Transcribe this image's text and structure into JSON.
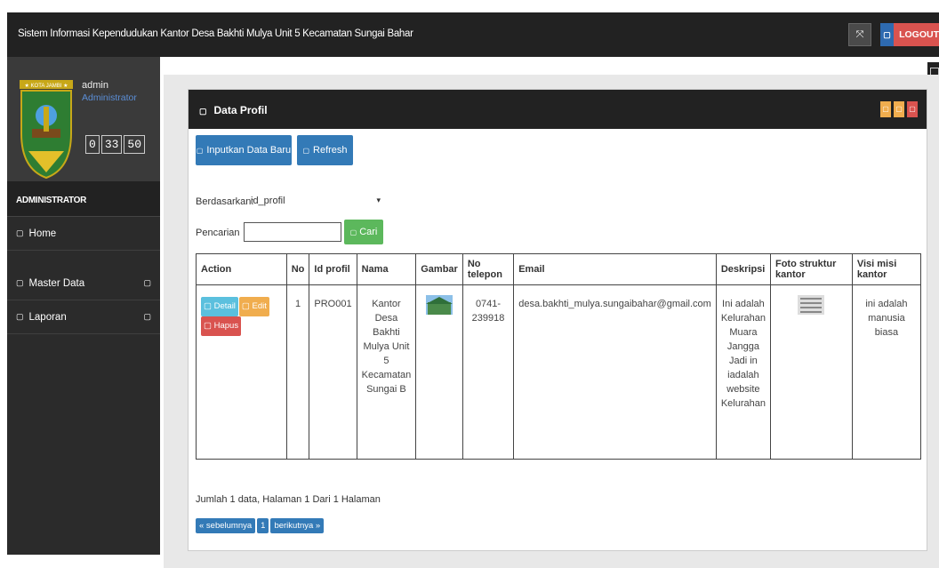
{
  "app": {
    "title": "Sistem Informasi Kependudukan Kantor Desa Bakhti Mulya Unit 5 Kecamatan Sungai Bahar",
    "logout_label": "LOGOUT",
    "expand_icon": "expand-icon",
    "accent": "#337ab7",
    "danger": "#d9534f"
  },
  "sidebar": {
    "user_name": "admin",
    "user_role": "Administrator",
    "clock": [
      "0",
      "33",
      "50"
    ],
    "section": "ADMINISTRATOR",
    "items": [
      {
        "label": "Home",
        "icon": "home-icon"
      },
      {
        "label": "Master Data",
        "icon": "folder-icon"
      },
      {
        "label": "Laporan",
        "icon": "report-icon"
      }
    ]
  },
  "panel": {
    "title": "Data Profil",
    "btn_new": "Inputkan Data Baru",
    "btn_refresh": "Refresh",
    "filter_label": "Berdasarkan:",
    "filter_value": "id_profil",
    "search_label": "Pencarian",
    "search_value": "",
    "search_button": "Cari"
  },
  "table": {
    "headers": [
      "Action",
      "No",
      "Id profil",
      "Nama",
      "Gambar",
      "No telepon",
      "Email",
      "Deskripsi",
      "Foto struktur kantor",
      "Visi misi kantor"
    ],
    "rows": [
      {
        "actions": [
          "Detail",
          "Edit",
          "Hapus"
        ],
        "no": "1",
        "id_profil": "PRO001",
        "nama": "Kantor Desa Bakhti Mulya Unit 5 Kecamatan Sungai B",
        "no_telepon": "0741-239918",
        "email": "desa.bakhti_mulya.sungaibahar@gmail.com",
        "deskripsi": "Ini adalah Kelurahan Muara Jangga Jadi in iadalah website Kelurahan",
        "visi_misi": "ini adalah manusia biasa"
      }
    ]
  },
  "footer": {
    "summary": "Jumlah 1 data, Halaman 1 Dari 1 Halaman",
    "prev": "« sebelumnya",
    "page": "1",
    "next": "berikutnya »"
  }
}
